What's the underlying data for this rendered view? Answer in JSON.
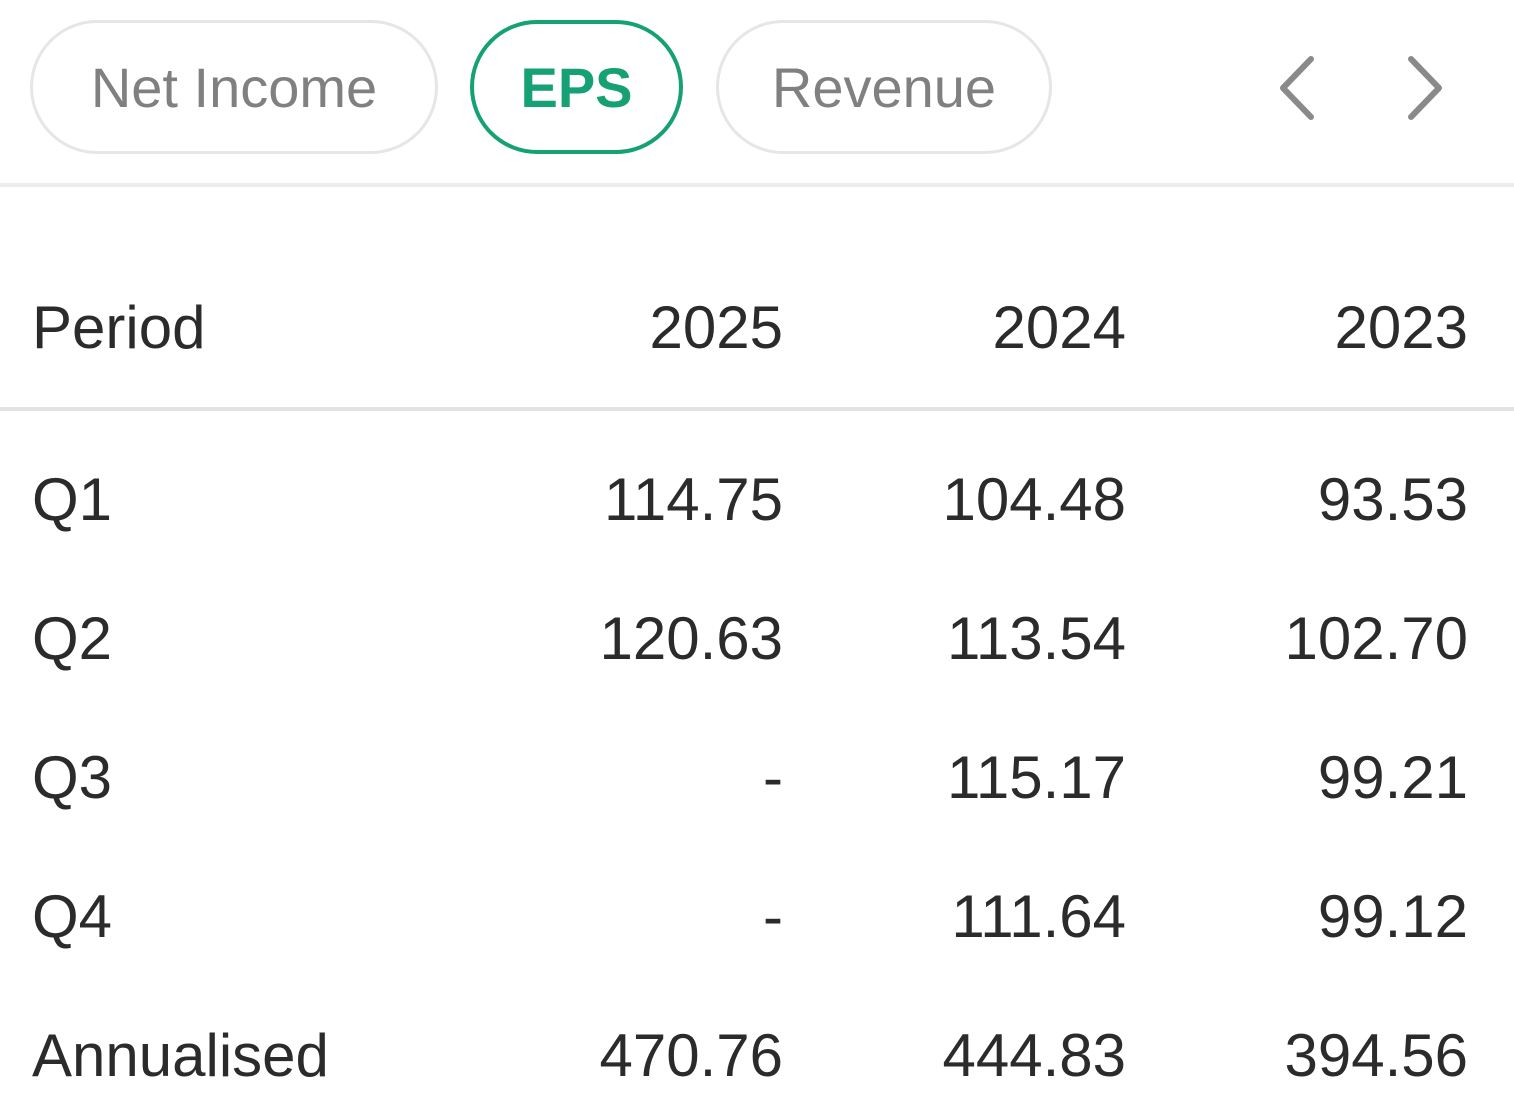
{
  "tabs": [
    {
      "label": "Net Income",
      "active": false
    },
    {
      "label": "EPS",
      "active": true
    },
    {
      "label": "Revenue",
      "active": false
    }
  ],
  "nav": {
    "prev_icon": "chevron-left-icon",
    "next_icon": "chevron-right-icon"
  },
  "colors": {
    "accent": "#16a174",
    "text": "#2b2b2b",
    "muted": "#808080",
    "border": "#e6e6e6"
  },
  "table": {
    "header": {
      "label": "Period",
      "columns": [
        "2025",
        "2024",
        "2023"
      ]
    },
    "rows": [
      {
        "label": "Q1",
        "values": [
          "114.75",
          "104.48",
          "93.53"
        ]
      },
      {
        "label": "Q2",
        "values": [
          "120.63",
          "113.54",
          "102.70"
        ]
      },
      {
        "label": "Q3",
        "values": [
          "-",
          "115.17",
          "99.21"
        ]
      },
      {
        "label": "Q4",
        "values": [
          "-",
          "111.64",
          "99.12"
        ]
      },
      {
        "label": "Annualised",
        "values": [
          "470.76",
          "444.83",
          "394.56"
        ]
      }
    ]
  }
}
